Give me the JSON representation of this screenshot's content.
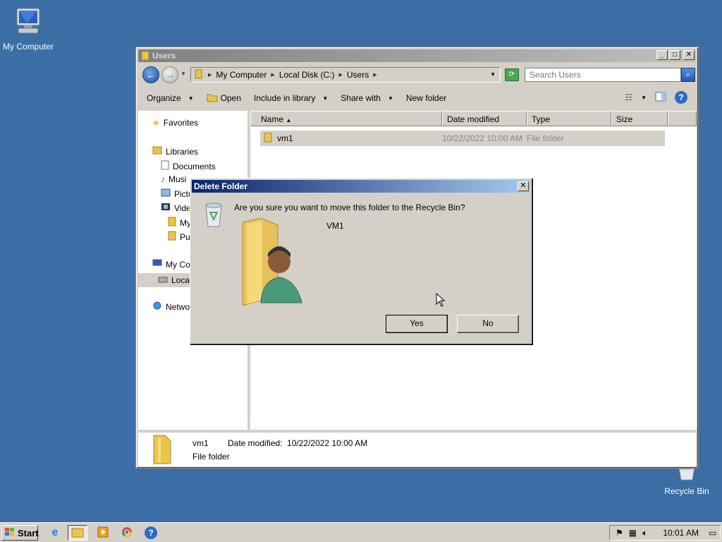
{
  "desktop": {
    "icons": [
      {
        "label": "My Computer",
        "icon": "computer-icon"
      },
      {
        "label": "Recycle Bin",
        "icon": "recycle-bin-icon"
      }
    ]
  },
  "explorer": {
    "title": "Users",
    "address": {
      "crumbs": [
        "My Computer",
        "Local Disk (C:)",
        "Users"
      ]
    },
    "search_placeholder": "Search Users",
    "toolbar": {
      "organize": "Organize",
      "open": "Open",
      "include_in_library": "Include in library",
      "share_with": "Share with",
      "new_folder": "New folder"
    },
    "nav": {
      "favorites": "Favorites",
      "libraries": "Libraries",
      "documents": "Documents",
      "music": "Musi",
      "pictures": "Pictu",
      "videos": "Video",
      "my": "My",
      "pu": "Pu",
      "my_computer": "My Comp",
      "local_disk": "Loca",
      "network": "Networ"
    },
    "columns": {
      "name": "Name",
      "date_modified": "Date modified",
      "type": "Type",
      "size": "Size"
    },
    "rows": [
      {
        "name": "vm1",
        "date": "10/22/2022 10:00 AM",
        "type": "File folder",
        "size": ""
      }
    ],
    "details": {
      "name": "vm1",
      "date_label": "Date modified:",
      "date_value": "10/22/2022 10:00 AM",
      "type": "File folder"
    }
  },
  "dialog": {
    "title": "Delete Folder",
    "message": "Are you sure you want to move this folder to the Recycle Bin?",
    "item_name": "VM1",
    "yes": "Yes",
    "no": "No"
  },
  "taskbar": {
    "start": "Start",
    "clock": "10:01 AM"
  }
}
